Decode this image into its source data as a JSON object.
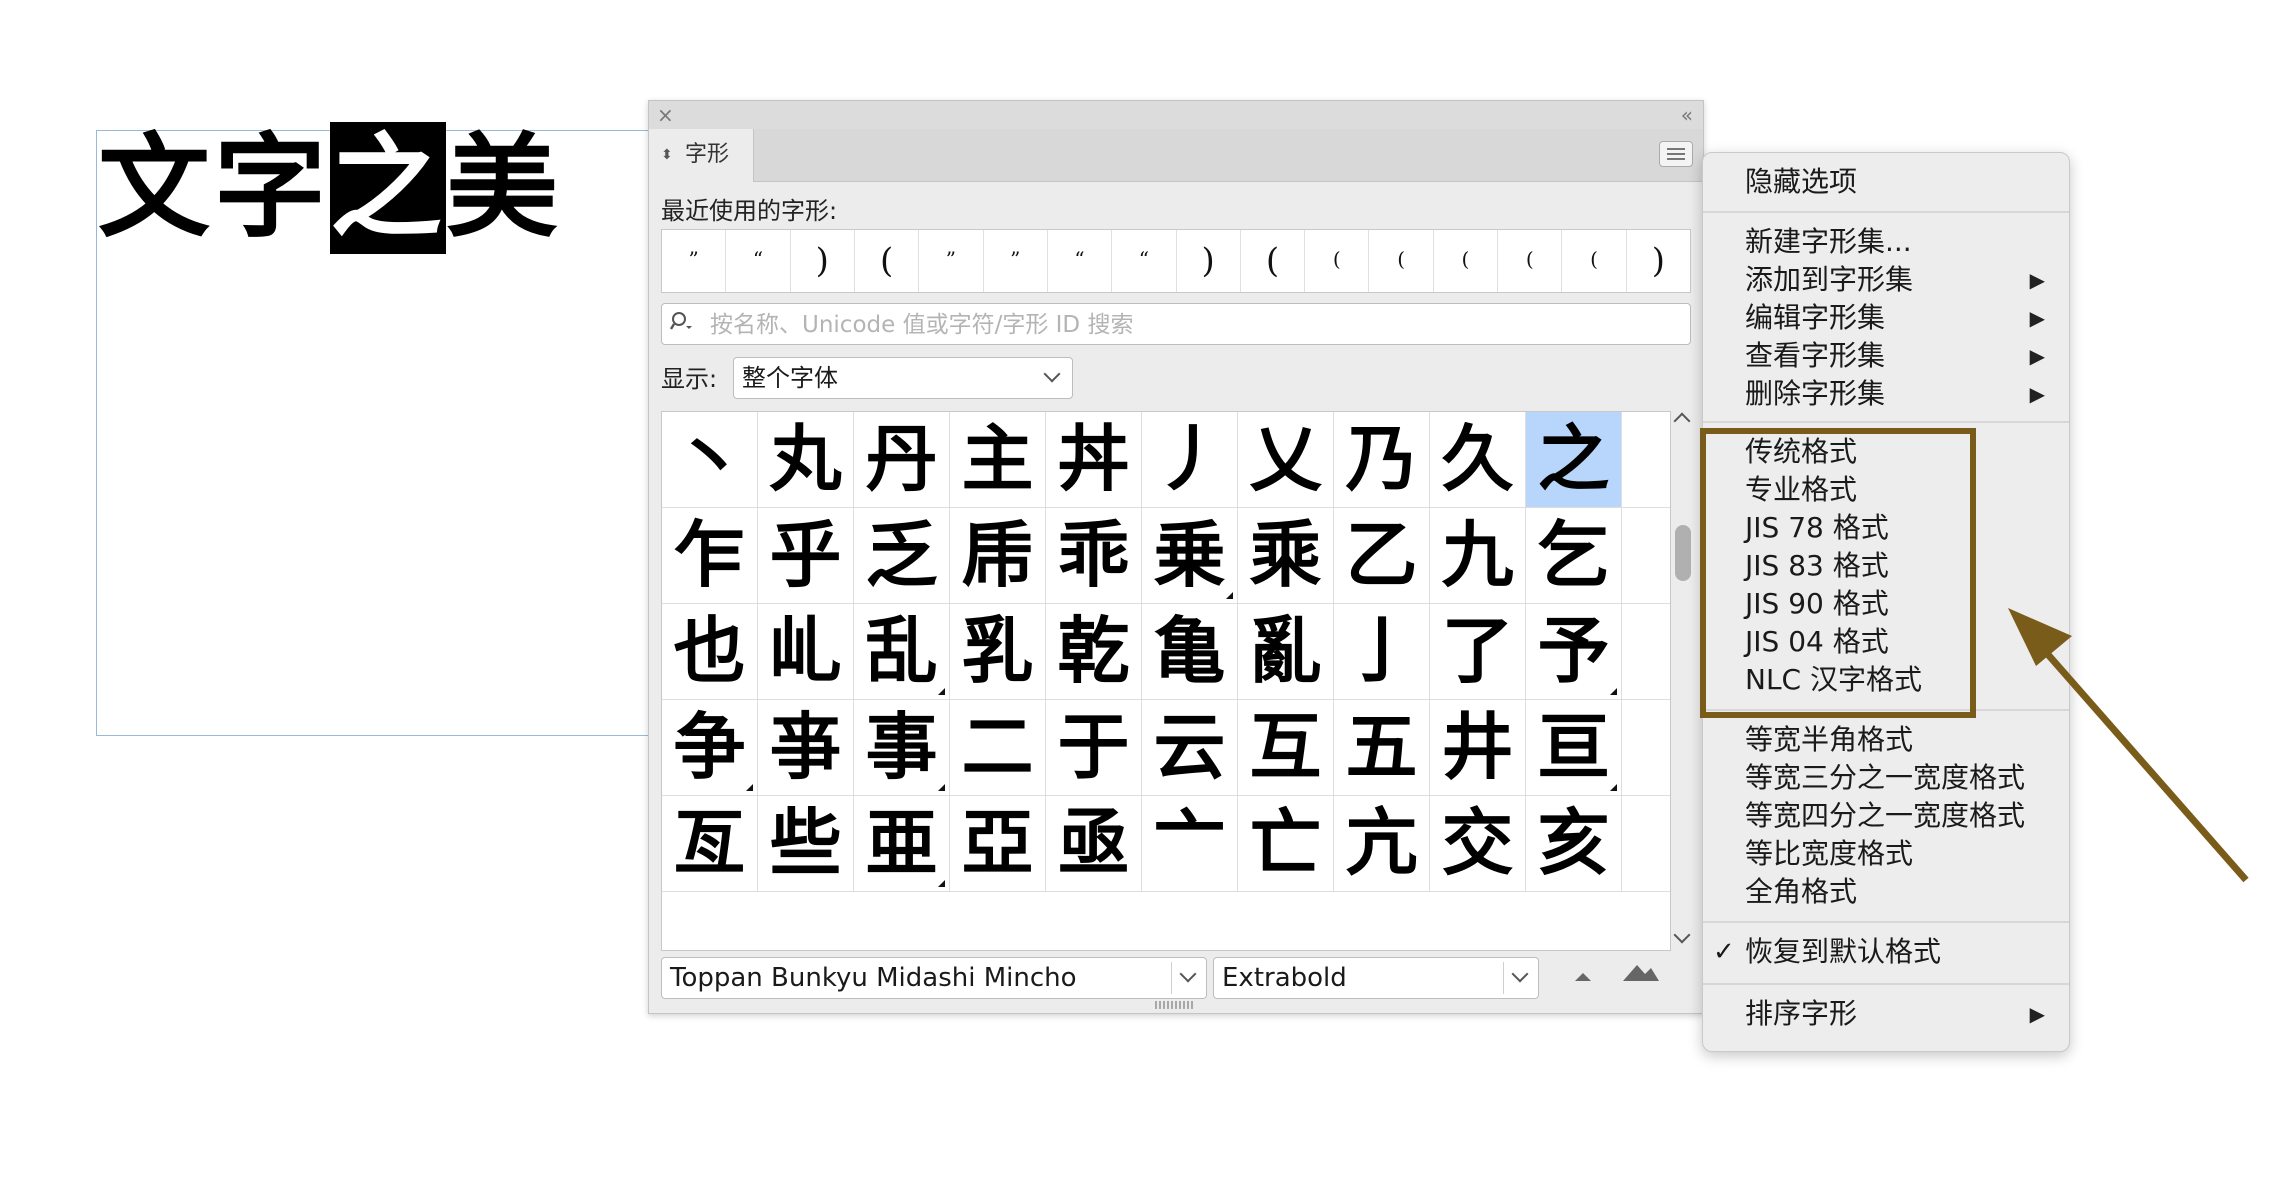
{
  "document": {
    "headline_chars": [
      "文",
      "字",
      "之",
      "美"
    ],
    "selected_char_index": 2
  },
  "glyph_panel": {
    "tab_label": "字形",
    "recent_label": "最近使用的字形:",
    "recent_glyphs": [
      "”",
      "“",
      ")",
      "(",
      "”",
      "”",
      "“",
      "“",
      ")",
      "(",
      "(",
      "(",
      "(",
      "(",
      "(",
      ")"
    ],
    "search_placeholder": "按名称、Unicode 值或字符/字形 ID 搜索",
    "show_label": "显示:",
    "show_value": "整个字体",
    "glyph_rows": [
      [
        "丶",
        "丸",
        "丹",
        "主",
        "丼",
        "丿",
        "乂",
        "乃",
        "久",
        "之"
      ],
      [
        "乍",
        "乎",
        "乏",
        "乕",
        "乖",
        "乗",
        "乘",
        "乙",
        "九",
        "乞"
      ],
      [
        "也",
        "乢",
        "乱",
        "乳",
        "乾",
        "亀",
        "亂",
        "亅",
        "了",
        "予"
      ],
      [
        "争",
        "亊",
        "事",
        "二",
        "于",
        "云",
        "互",
        "五",
        "井",
        "亘"
      ],
      [
        "亙",
        "些",
        "亜",
        "亞",
        "亟",
        "亠",
        "亡",
        "亢",
        "交",
        "亥"
      ]
    ],
    "selected_glyph": "之",
    "alt_marked_glyphs": [
      "乗",
      "乱",
      "予",
      "争",
      "事",
      "亘",
      "亜"
    ],
    "font_family": "Toppan Bunkyu Midashi Mincho",
    "font_style": "Extrabold"
  },
  "flyout_menu": {
    "items": [
      {
        "label": "隐藏选项"
      },
      {
        "label": "新建字形集..."
      },
      {
        "label": "添加到字形集",
        "submenu": "▶"
      },
      {
        "label": "编辑字形集",
        "submenu": "▶"
      },
      {
        "label": "查看字形集",
        "submenu": "▶"
      },
      {
        "label": "删除字形集",
        "submenu": "▶"
      },
      {
        "label": "传统格式"
      },
      {
        "label": "专业格式"
      },
      {
        "label": "JIS 78 格式"
      },
      {
        "label": "JIS 83 格式"
      },
      {
        "label": "JIS 90 格式"
      },
      {
        "label": "JIS 04 格式"
      },
      {
        "label": "NLC 汉字格式"
      },
      {
        "label": "等宽半角格式"
      },
      {
        "label": "等宽三分之一宽度格式"
      },
      {
        "label": "等宽四分之一宽度格式"
      },
      {
        "label": "等比宽度格式"
      },
      {
        "label": "全角格式"
      },
      {
        "label": "恢复到默认格式",
        "check": "✓"
      },
      {
        "label": "排序字形",
        "submenu": "▶"
      }
    ]
  },
  "annotation": {
    "color": "#7a5c1a"
  },
  "colors": {
    "selection_highlight": "#b8d6fb",
    "text_frame_border": "#9ab8d8"
  }
}
